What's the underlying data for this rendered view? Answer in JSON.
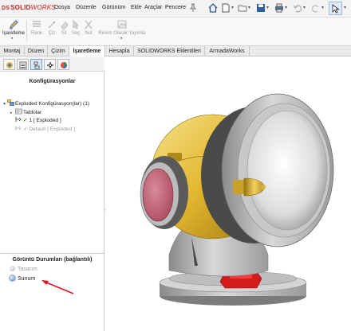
{
  "app": {
    "logo_prefix": "DS",
    "logo_bold": "SOLID",
    "logo_rest": "WORKS"
  },
  "menu": [
    "Dosya",
    "Düzenle",
    "Görünüm",
    "Ekle",
    "Araçlar",
    "Pencere"
  ],
  "quick_access": {
    "icons": [
      "home-icon",
      "new-document-icon",
      "open-folder-icon",
      "save-icon",
      "print-icon",
      "undo-icon",
      "redo-icon",
      "select-arrow-icon"
    ]
  },
  "command_manager": {
    "items": [
      {
        "label": "İşaretleme",
        "icon": "markup-icon",
        "active": true
      },
      {
        "label": "Renk",
        "icon": "color-icon",
        "active": false
      },
      {
        "label": "Çiz",
        "icon": "draw-icon",
        "active": false
      },
      {
        "label": "Sil",
        "icon": "erase-icon",
        "active": false
      },
      {
        "label": "Seç",
        "icon": "select-icon",
        "active": false
      },
      {
        "label": "Not",
        "icon": "note-icon",
        "active": false
      },
      {
        "label": "Resim Olarak Yayımla",
        "icon": "publish-image-icon",
        "active": false
      }
    ]
  },
  "tabs": [
    {
      "label": "Montaj",
      "active": false
    },
    {
      "label": "Düzen",
      "active": false
    },
    {
      "label": "Çizim",
      "active": false
    },
    {
      "label": "İşaretleme",
      "active": true
    },
    {
      "label": "Hesapla",
      "active": false
    },
    {
      "label": "SOLIDWORKS Eklentileri",
      "active": false
    },
    {
      "label": "ArmadaWorks",
      "active": false
    }
  ],
  "panel": {
    "title": "Konfigürasyonlar",
    "tree": {
      "root": "Exploded Konfigürasyon(lar)  (1)",
      "tables": "Tablolar",
      "config_active": "1 [ Exploded ]",
      "config_default": "Default [ Exploded ]"
    }
  },
  "display_states": {
    "title": "Görüntü Durumları (bağlantılı)",
    "items": [
      {
        "label": "Tasarım",
        "active": false
      },
      {
        "label": "Sunum",
        "active": true
      }
    ]
  },
  "colors": {
    "accent": "#3a6fb0",
    "brand": "#d2201b",
    "annotation_arrow": "#e0141e"
  }
}
